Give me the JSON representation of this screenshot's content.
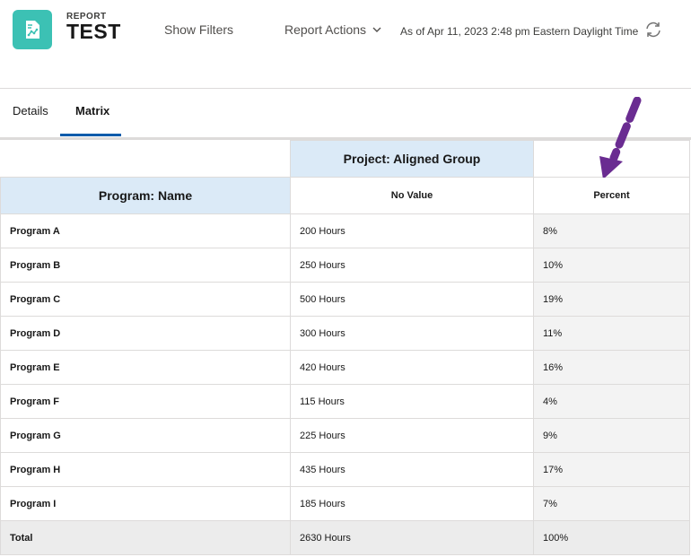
{
  "header": {
    "eyebrow": "REPORT",
    "title": "TEST",
    "show_filters": "Show Filters",
    "report_actions": "Report Actions",
    "as_of": "As of Apr 11, 2023 2:48 pm Eastern Daylight Time"
  },
  "tabs": [
    {
      "label": "Details",
      "active": false
    },
    {
      "label": "Matrix",
      "active": true
    }
  ],
  "matrix": {
    "group_header": "Project: Aligned Group",
    "row_header": "Program: Name",
    "col_no_value": "No Value",
    "col_percent": "Percent",
    "rows": [
      {
        "name": "Program A",
        "hours": "200 Hours",
        "percent": "8%"
      },
      {
        "name": "Program B",
        "hours": "250 Hours",
        "percent": "10%"
      },
      {
        "name": "Program C",
        "hours": "500 Hours",
        "percent": "19%"
      },
      {
        "name": "Program D",
        "hours": "300 Hours",
        "percent": "11%"
      },
      {
        "name": "Program E",
        "hours": "420 Hours",
        "percent": "16%"
      },
      {
        "name": "Program F",
        "hours": "115 Hours",
        "percent": "4%"
      },
      {
        "name": "Program G",
        "hours": "225 Hours",
        "percent": "9%"
      },
      {
        "name": "Program H",
        "hours": "435 Hours",
        "percent": "17%"
      },
      {
        "name": "Program I",
        "hours": "185 Hours",
        "percent": "7%"
      }
    ],
    "total": {
      "name": "Total",
      "hours": "2630 Hours",
      "percent": "100%"
    }
  },
  "colors": {
    "app_icon": "#3cc1b4",
    "header_blue": "#dbeaf7",
    "tab_active": "#0b5cab",
    "annotation_arrow": "#6a2c91"
  }
}
